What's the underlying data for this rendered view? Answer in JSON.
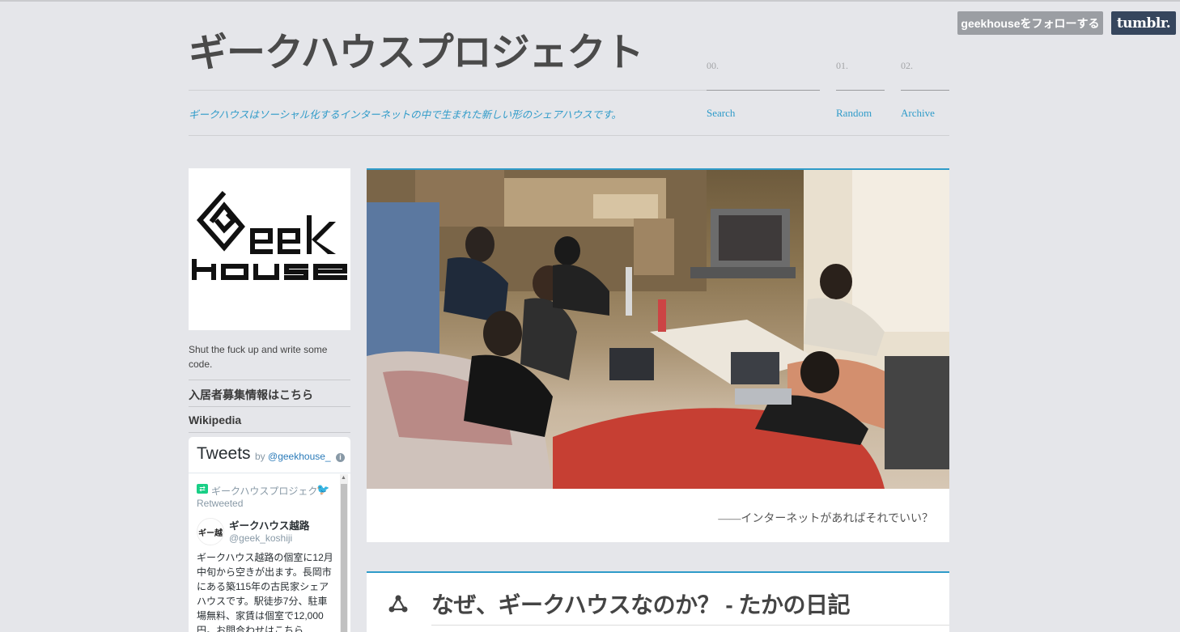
{
  "tumblr": {
    "follow_label": "geekhouseをフォローする",
    "logo_label": "tumblr."
  },
  "header": {
    "title": "ギークハウスプロジェクト",
    "tagline": "ギークハウスはソーシャル化するインターネットの中で生まれた新しい形のシェアハウスです。",
    "nav": [
      {
        "num": "00.",
        "label": "Search"
      },
      {
        "num": "01.",
        "label": "Random"
      },
      {
        "num": "02.",
        "label": "Archive"
      }
    ]
  },
  "sidebar": {
    "logo_text": "Geek house",
    "description": "Shut the fuck up and write some code.",
    "links": [
      "入居者募集情報はこちら",
      "Wikipedia"
    ]
  },
  "tweets": {
    "title": "Tweets",
    "by": "by",
    "handle": "@geekhouse_",
    "retweeter": "ギークハウスプロジェクト",
    "retweeted": "Retweeted",
    "avatar_text": "ギー越",
    "author_name": "ギークハウス越路",
    "author_handle": "@geek_koshiji",
    "body": "ギークハウス越路の個室に12月中旬から空きが出ます。長岡市にある築115年の古民家シェアハウスです。駅徒歩7分、駐車場無料、家賃は個室で12,000円。お問合わせはこちら"
  },
  "posts": {
    "photo_caption": "――インターネットがあればそれでいい？",
    "link_title": "なぜ、ギークハウスなのか？ - たかの日記"
  },
  "colors": {
    "accent": "#2f9bc9",
    "background": "#e5e6ea",
    "tumblr_blue": "#36465d"
  }
}
